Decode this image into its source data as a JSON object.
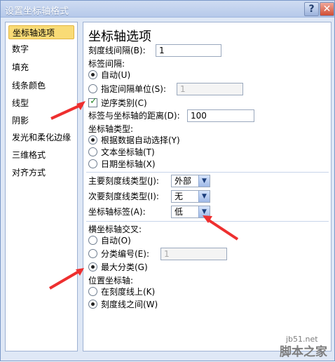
{
  "window": {
    "title": "设置坐标轴格式",
    "help_label": "?",
    "close_label": "✕"
  },
  "nav": {
    "items": [
      "坐标轴选项",
      "数字",
      "填充",
      "线条颜色",
      "线型",
      "阴影",
      "发光和柔化边缘",
      "三维格式",
      "对齐方式"
    ],
    "selected": "坐标轴选项"
  },
  "axis": {
    "header": "坐标轴选项",
    "tick_interval_label": "刻度线间隔(B):",
    "tick_interval_value": "1",
    "label_interval_header": "标签间隔:",
    "auto_label": "自动(U)",
    "specify_label": "指定间隔单位(S):",
    "specify_value": "1",
    "reverse_label": "逆序类别(C)",
    "distance_label": "标签与坐标轴的距离(D):",
    "distance_value": "100",
    "axis_type_header": "坐标轴类型:",
    "auto_select_label": "根据数据自动选择(Y)",
    "text_axis_label": "文本坐标轴(T)",
    "date_axis_label": "日期坐标轴(X)",
    "major_tick_label": "主要刻度线类型(J):",
    "major_tick_value": "外部",
    "minor_tick_label": "次要刻度线类型(I):",
    "minor_tick_value": "无",
    "axis_labels_label": "坐标轴标签(A):",
    "axis_labels_value": "低",
    "crosses_header": "横坐标轴交叉:",
    "crosses_auto": "自动(O)",
    "crosses_category_label": "分类编号(E):",
    "crosses_category_value": "1",
    "crosses_max": "最大分类(G)",
    "position_header": "位置坐标轴:",
    "on_tick_label": "在刻度线上(K)",
    "between_tick_label": "刻度线之间(W)"
  },
  "watermark": {
    "site": "jb51.net",
    "brand": "脚本之家"
  }
}
